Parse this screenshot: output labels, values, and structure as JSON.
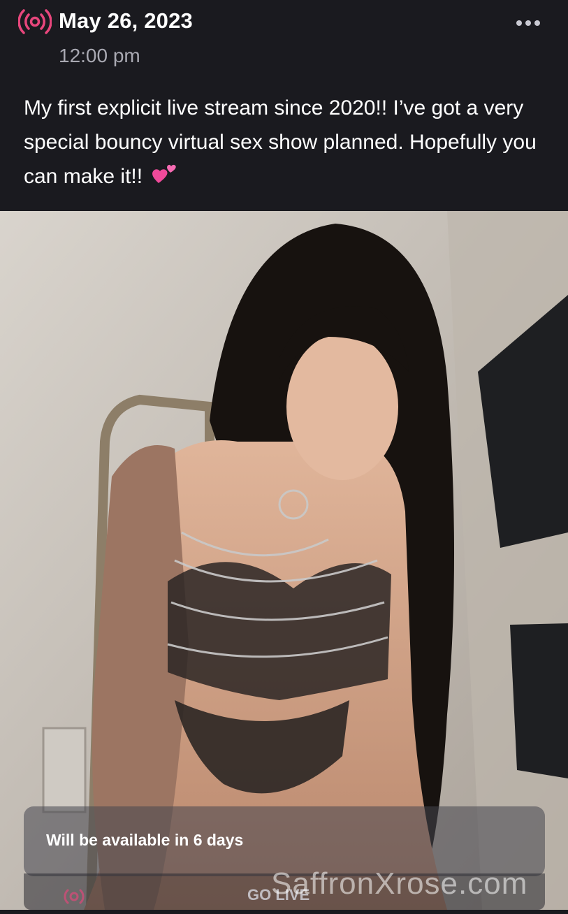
{
  "post": {
    "date": "May 26, 2023",
    "time": "12:00 pm",
    "text": "My first explicit live stream since 2020!! I’ve got a very special bouncy virtual sex show planned. Hopefully you can make it!!",
    "emoji": "💕"
  },
  "icons": {
    "live": "live-broadcast-icon",
    "more": "more-dots-icon",
    "heart": "two-hearts-emoji"
  },
  "media": {
    "availability_text": "Will be available in 6 days",
    "go_live_label": "GO LIVE",
    "watermark": "SaffronXrose.com"
  },
  "colors": {
    "accent": "#e8467c",
    "background": "#1a1a1f",
    "muted_text": "#a9a9b2"
  }
}
